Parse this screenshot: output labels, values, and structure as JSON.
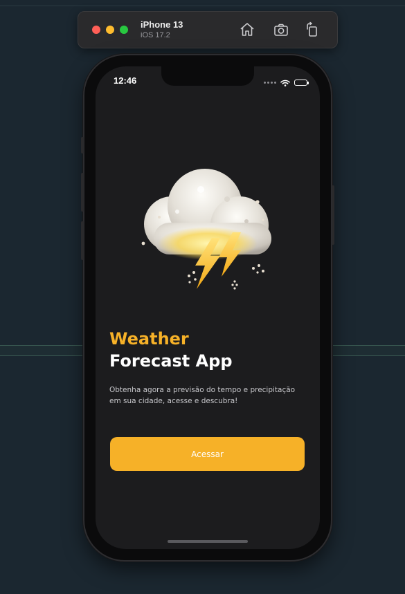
{
  "simulator": {
    "device_name": "iPhone 13",
    "os_version": "iOS 17.2",
    "buttons": [
      {
        "name": "home",
        "icon": "home-icon"
      },
      {
        "name": "screenshot",
        "icon": "camera-icon"
      },
      {
        "name": "rotate",
        "icon": "rotate-icon"
      }
    ]
  },
  "status_bar": {
    "time": "12:46",
    "icons": [
      "signal-icon",
      "wifi-icon",
      "battery-icon"
    ]
  },
  "onboarding": {
    "illustration": "storm-cloud-icon",
    "title_accent": "Weather",
    "title_main": "Forecast App",
    "subtitle": "Obtenha agora a previsão do tempo e precipitação em sua cidade, acesse e descubra!",
    "button_label": "Acessar"
  },
  "colors": {
    "accent": "#f6b128",
    "screen_background": "#1c1c1e",
    "desktop_background": "#1b2730"
  }
}
